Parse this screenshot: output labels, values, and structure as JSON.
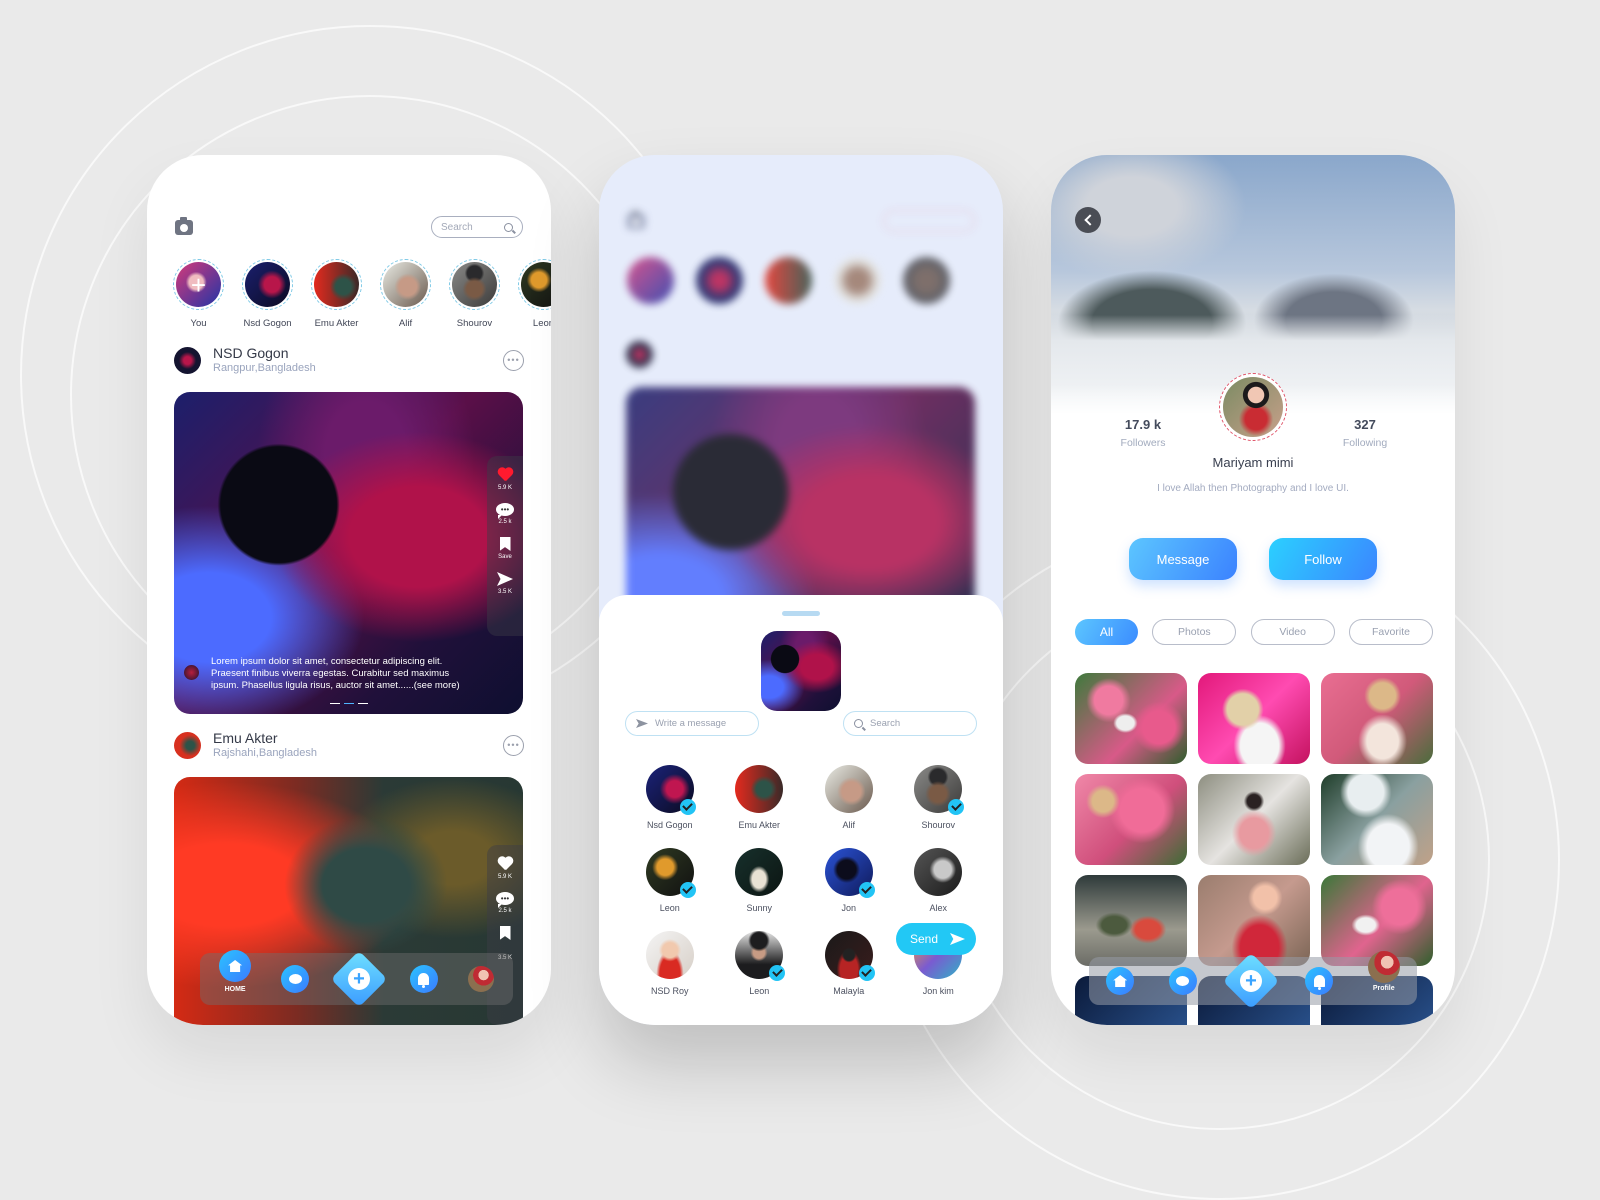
{
  "theme": {
    "accent": "#3b8cff",
    "accent_light": "#2bc3ff",
    "like_red": "#ff1a2e",
    "verified": "#22c4f5",
    "background": "#eaeaea"
  },
  "feed": {
    "camera_icon": "camera-icon",
    "search_placeholder": "Search",
    "stories": [
      {
        "name": "You",
        "is_add": true
      },
      {
        "name": "Nsd Gogon"
      },
      {
        "name": "Emu Akter"
      },
      {
        "name": "Alif"
      },
      {
        "name": "Shourov"
      },
      {
        "name": "Leon"
      }
    ],
    "posts": [
      {
        "author": "NSD Gogon",
        "location": "Rangpur,Bangladesh",
        "likes": "5.9 K",
        "comments": "2.5 k",
        "save_label": "Save",
        "shares": "3.5 K",
        "liked": true,
        "caption": "Lorem ipsum dolor sit amet, consectetur adipiscing elit. Praesent finibus viverra egestas. Curabitur sed maximus ipsum. Phasellus ligula risus, auctor sit amet......(see more)",
        "slide_count": 3,
        "active_slide": 2
      },
      {
        "author": "Emu Akter",
        "location": "Rajshahi,Bangladesh",
        "likes": "5.9 K",
        "comments": "2.5 k",
        "shares": "3.5 K",
        "liked": false
      }
    ],
    "nav": {
      "home_label": "HOME"
    }
  },
  "share": {
    "message_placeholder": "Write a message",
    "search_placeholder": "Search",
    "contacts": [
      {
        "name": "Nsd Gogon",
        "selected": true
      },
      {
        "name": "Emu Akter",
        "selected": false
      },
      {
        "name": "Alif",
        "selected": false
      },
      {
        "name": "Shourov",
        "selected": true
      },
      {
        "name": "Leon",
        "selected": true
      },
      {
        "name": "Sunny",
        "selected": false
      },
      {
        "name": "Jon",
        "selected": true
      },
      {
        "name": "Alex",
        "selected": false
      },
      {
        "name": "NSD Roy",
        "selected": false
      },
      {
        "name": "Leon",
        "selected": true
      },
      {
        "name": "Malayla",
        "selected": true
      },
      {
        "name": "Jon kim",
        "selected": false
      }
    ],
    "send_label": "Send"
  },
  "profile": {
    "followers_count": "17.9 k",
    "followers_label": "Followers",
    "following_count": "327",
    "following_label": "Following",
    "name": "Mariyam mimi",
    "bio": "I love Allah then Photography and I love UI.",
    "message_label": "Message",
    "follow_label": "Follow",
    "tabs": [
      {
        "label": "All",
        "active": true
      },
      {
        "label": "Photos",
        "active": false
      },
      {
        "label": "Video",
        "active": false
      },
      {
        "label": "Favorite",
        "active": false
      }
    ],
    "gallery_count": 12,
    "nav": {
      "profile_label": "Profile"
    }
  }
}
